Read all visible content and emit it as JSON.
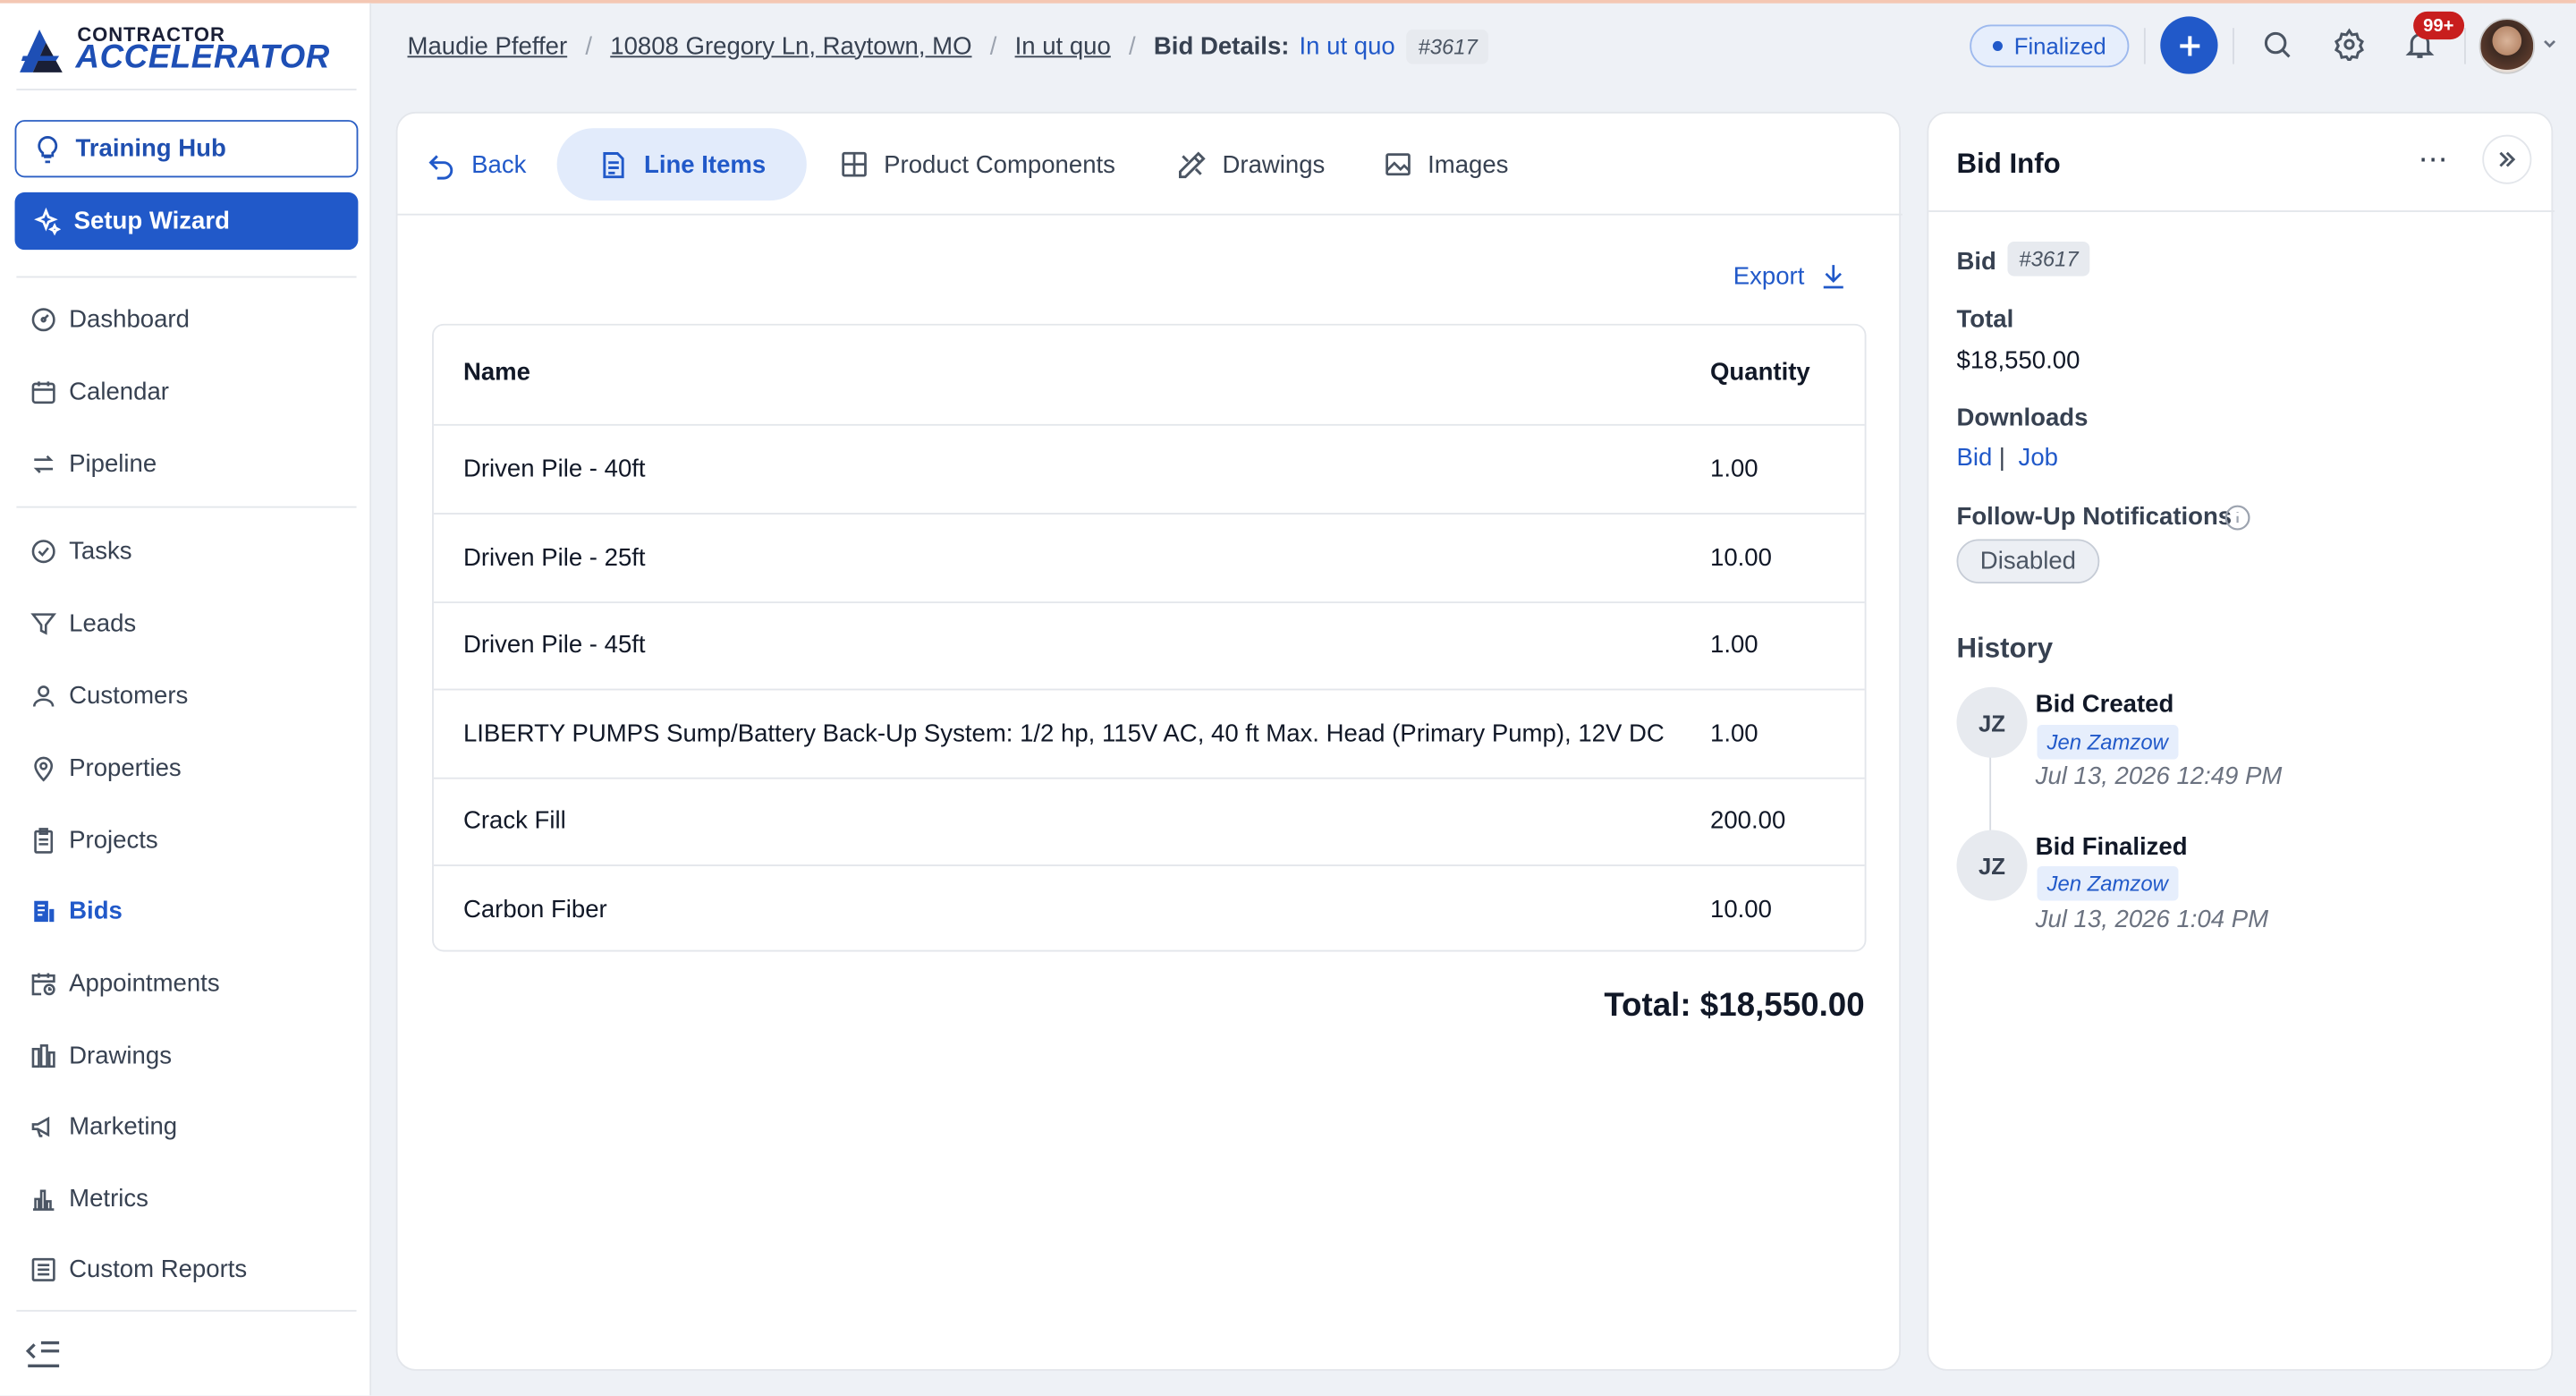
{
  "brand": {
    "line1": "CONTRACTOR",
    "line2": "ACCELERATOR"
  },
  "sidebar": {
    "training_hub": "Training Hub",
    "setup_wizard": "Setup Wizard",
    "items": [
      {
        "label": "Dashboard",
        "icon": "dashboard-icon"
      },
      {
        "label": "Calendar",
        "icon": "calendar-icon"
      },
      {
        "label": "Pipeline",
        "icon": "pipeline-icon"
      },
      {
        "label": "Tasks",
        "icon": "tasks-icon"
      },
      {
        "label": "Leads",
        "icon": "filter-icon"
      },
      {
        "label": "Customers",
        "icon": "user-icon"
      },
      {
        "label": "Properties",
        "icon": "location-pin-icon"
      },
      {
        "label": "Projects",
        "icon": "clipboard-icon"
      },
      {
        "label": "Bids",
        "icon": "bids-icon",
        "active": true
      },
      {
        "label": "Appointments",
        "icon": "calendar-clock-icon"
      },
      {
        "label": "Drawings",
        "icon": "drawings-icon"
      },
      {
        "label": "Marketing",
        "icon": "megaphone-icon"
      },
      {
        "label": "Metrics",
        "icon": "bar-chart-icon"
      },
      {
        "label": "Custom Reports",
        "icon": "list-report-icon"
      }
    ]
  },
  "breadcrumb": {
    "customer": "Maudie Pfeffer",
    "address": "10808 Gregory Ln, Raytown, MO",
    "project": "In ut quo",
    "current_label": "Bid Details:",
    "current_value": "In ut quo",
    "bid_number": "#3617"
  },
  "header": {
    "status": "Finalized",
    "notifications_badge": "99+"
  },
  "tabs": {
    "back": "Back",
    "line_items": "Line Items",
    "product_components": "Product Components",
    "drawings": "Drawings",
    "images": "Images"
  },
  "line_items": {
    "export_label": "Export",
    "columns": {
      "name": "Name",
      "quantity": "Quantity"
    },
    "rows": [
      {
        "name": "Driven Pile - 40ft",
        "quantity": "1.00"
      },
      {
        "name": "Driven Pile - 25ft",
        "quantity": "10.00"
      },
      {
        "name": "Driven Pile - 45ft",
        "quantity": "1.00"
      },
      {
        "name": "LIBERTY PUMPS Sump/Battery Back-Up System: 1/2 hp, 115V AC, 40 ft Max. Head (Primary Pump), 12V DC",
        "quantity": "1.00"
      },
      {
        "name": "Crack Fill",
        "quantity": "200.00"
      },
      {
        "name": "Carbon Fiber",
        "quantity": "10.00"
      }
    ],
    "total": "Total: $18,550.00"
  },
  "bid_info": {
    "title": "Bid Info",
    "bid_label": "Bid",
    "bid_number": "#3617",
    "total_label": "Total",
    "total_value": "$18,550.00",
    "downloads_label": "Downloads",
    "download_bid": "Bid",
    "download_separator": "|",
    "download_job": "Job",
    "followup_label": "Follow-Up Notifications",
    "followup_status": "Disabled",
    "history_title": "History",
    "history": [
      {
        "initials": "JZ",
        "event": "Bid Created",
        "user": "Jen Zamzow",
        "date": "Jul 13, 2026 12:49 PM"
      },
      {
        "initials": "JZ",
        "event": "Bid Finalized",
        "user": "Jen Zamzow",
        "date": "Jul 13, 2026 1:04 PM"
      }
    ]
  },
  "colors": {
    "accent": "#2159c9",
    "badge": "#c81e1e",
    "background": "#eef1f6"
  }
}
